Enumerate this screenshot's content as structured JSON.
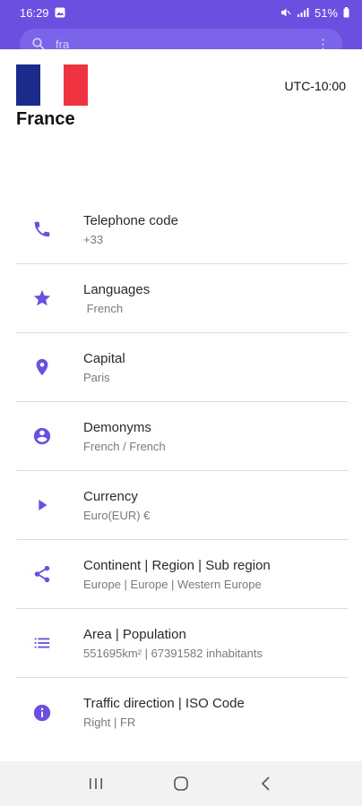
{
  "status_bar": {
    "time": "16:29",
    "battery": "51%"
  },
  "search": {
    "query": "fra"
  },
  "country": {
    "name": "France",
    "utc_offset": "UTC-10:00",
    "flag_colors": [
      "#1a2b8c",
      "#ffffff",
      "#ef3340"
    ]
  },
  "accent_color": "#6a4fe0",
  "rows": [
    {
      "icon": "phone-icon",
      "title": "Telephone code",
      "value": "+33"
    },
    {
      "icon": "star-icon",
      "title": "Languages",
      "value": " French"
    },
    {
      "icon": "location-pin-icon",
      "title": "Capital",
      "value": "Paris"
    },
    {
      "icon": "account-circle-icon",
      "title": "Demonyms",
      "value": "French / French"
    },
    {
      "icon": "play-arrow-icon",
      "title": "Currency",
      "value": "Euro(EUR) €"
    },
    {
      "icon": "share-icon",
      "title": "Continent | Region | Sub region",
      "value": "Europe | Europe | Western Europe"
    },
    {
      "icon": "list-icon",
      "title": "Area | Population",
      "value": "551695km² | 67391582 inhabitants"
    },
    {
      "icon": "info-icon",
      "title": "Traffic direction | ISO Code",
      "value": "Right | FR"
    }
  ]
}
